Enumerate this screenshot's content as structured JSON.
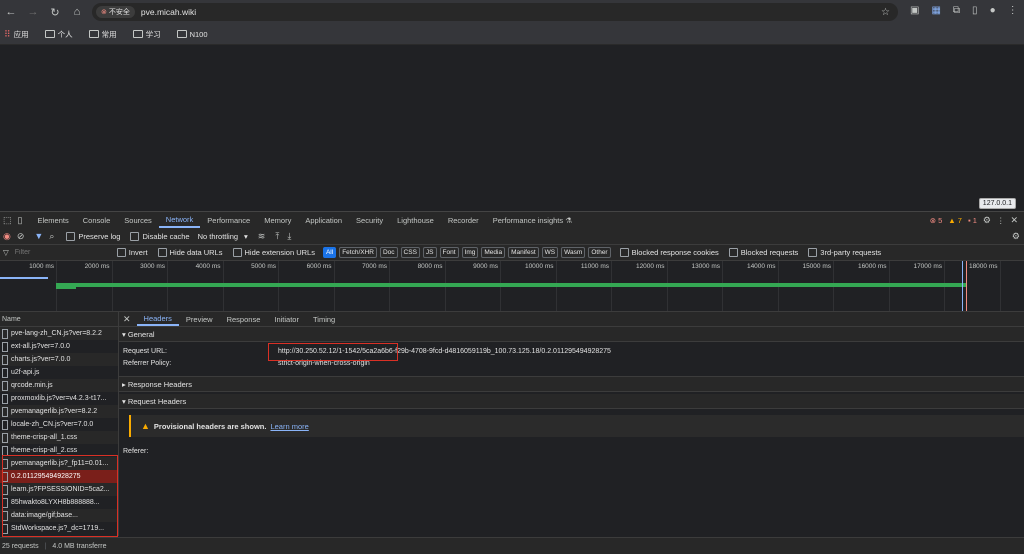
{
  "browser": {
    "security_label": "不安全",
    "url": "pve.micah.wiki",
    "bookmarks": [
      "应用",
      "个人",
      "常用",
      "学习",
      "N100"
    ]
  },
  "tooltip": "127.0.0.1",
  "devtools": {
    "tabs": [
      "Elements",
      "Console",
      "Sources",
      "Network",
      "Performance",
      "Memory",
      "Application",
      "Security",
      "Lighthouse",
      "Recorder",
      "Performance insights ⚗"
    ],
    "errors": "5",
    "warnings": "7",
    "issues": "1"
  },
  "network_toolbar": {
    "preserve_log": "Preserve log",
    "disable_cache": "Disable cache",
    "throttling": "No throttling"
  },
  "filter_bar": {
    "placeholder": "Filter",
    "invert": "Invert",
    "hide_data_urls": "Hide data URLs",
    "hide_extension_urls": "Hide extension URLs",
    "types": [
      "All",
      "Fetch/XHR",
      "Doc",
      "CSS",
      "JS",
      "Font",
      "Img",
      "Media",
      "Manifest",
      "WS",
      "Wasm",
      "Other"
    ],
    "blocked_response_cookies": "Blocked response cookies",
    "blocked_requests": "Blocked requests",
    "third_party": "3rd-party requests"
  },
  "timeline": {
    "ticks": [
      "1000 ms",
      "2000 ms",
      "3000 ms",
      "4000 ms",
      "5000 ms",
      "6000 ms",
      "7000 ms",
      "8000 ms",
      "9000 ms",
      "10000 ms",
      "11000 ms",
      "12000 ms",
      "13000 ms",
      "14000 ms",
      "15000 ms",
      "16000 ms",
      "17000 ms",
      "18000 ms"
    ]
  },
  "request_list": {
    "header": "Name",
    "items": [
      {
        "name": "pve-lang-zh_CN.js?ver=8.2.2",
        "status": "ok"
      },
      {
        "name": "ext-all.js?ver=7.0.0",
        "status": "ok"
      },
      {
        "name": "charts.js?ver=7.0.0",
        "status": "ok"
      },
      {
        "name": "u2f-api.js",
        "status": "ok"
      },
      {
        "name": "qrcode.min.js",
        "status": "ok"
      },
      {
        "name": "proxmoxlib.js?ver=v4.2.3-t17...",
        "status": "ok"
      },
      {
        "name": "pvemanagerlib.js?ver=8.2.2",
        "status": "ok"
      },
      {
        "name": "locale-zh_CN.js?ver=7.0.0",
        "status": "ok"
      },
      {
        "name": "theme-crisp-all_1.css",
        "status": "ok"
      },
      {
        "name": "theme-crisp-all_2.css",
        "status": "ok"
      },
      {
        "name": "pvemanagerlib.js?_fp11=0.01...",
        "status": "ok"
      },
      {
        "name": "0.2.011295494928275",
        "status": "selected"
      },
      {
        "name": "learn.js?FPSESSIONID=5ca2...",
        "status": "ok"
      },
      {
        "name": "85hwakto8LYXH8b888888...",
        "status": "ok"
      },
      {
        "name": "data:image/gif;base...",
        "status": "ok"
      },
      {
        "name": "StdWorkspace.js?_dc=1719...",
        "status": "ok"
      }
    ]
  },
  "status_bar": {
    "requests": "25 requests",
    "transferred": "4.0 MB transferre"
  },
  "details": {
    "tabs": [
      "Headers",
      "Preview",
      "Response",
      "Initiator",
      "Timing"
    ],
    "general_title": "▾ General",
    "request_url_label": "Request URL:",
    "request_url": "http://30.250.52.12/1-1542/5ca2a6b6-f29b-4708-9fcd-d4816059119b_100.73.125.18/0.2.011295494928275",
    "referrer_policy_label": "Referrer Policy:",
    "referrer_policy": "strict-origin-when-cross-origin",
    "response_headers_title": "▸ Response Headers",
    "request_headers_title": "▾ Request Headers",
    "provisional_text": "Provisional headers are shown.",
    "learn_more": "Learn more",
    "referer_label": "Referer:"
  },
  "colors": {
    "accent": "#8ab4f8",
    "error": "#f28b82",
    "annotation_red": "#d93025",
    "warning": "#f9ab00"
  }
}
